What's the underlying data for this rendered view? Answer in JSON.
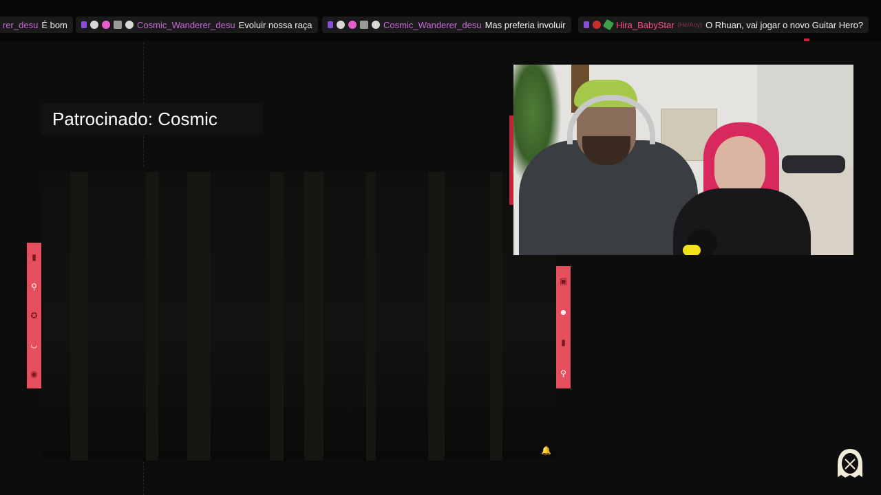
{
  "ticker": {
    "messages": [
      {
        "user": "rer_desu",
        "text": "É bom",
        "badges": []
      },
      {
        "user": "Cosmic_Wanderer_desu",
        "text": "Evoluir nossa raça",
        "badges": [
          "purple",
          "white",
          "pink",
          "gray",
          "white"
        ]
      },
      {
        "user": "Cosmic_Wanderer_desu",
        "text": "Mas preferia involuir",
        "badges": [
          "purple",
          "white",
          "pink",
          "gray",
          "white"
        ]
      },
      {
        "user": "Hira_BabyStar",
        "pronoun": "(He/Any)",
        "text": "O Rhuan, vai jogar o novo Guitar Hero?",
        "badges": [
          "purple",
          "red",
          "green"
        ]
      }
    ]
  },
  "overlay": {
    "title": "Patrocinado: Cosmic"
  },
  "icons": {
    "left_strip": [
      "tarot-card-icon",
      "spoon-icon",
      "pentagram-icon",
      "crescent-icon",
      "skull-icon"
    ],
    "right_strip": [
      "lantern-icon",
      "smile-icon",
      "tarot-card-icon",
      "spoon-icon"
    ],
    "game_corner": "bell-icon",
    "logo": "ghost-logo-icon"
  },
  "colors": {
    "accent_red": "#e64f5e",
    "username_purple": "#c66ad8",
    "username_pink": "#ff4d8d",
    "background": "#0d0d0d"
  }
}
